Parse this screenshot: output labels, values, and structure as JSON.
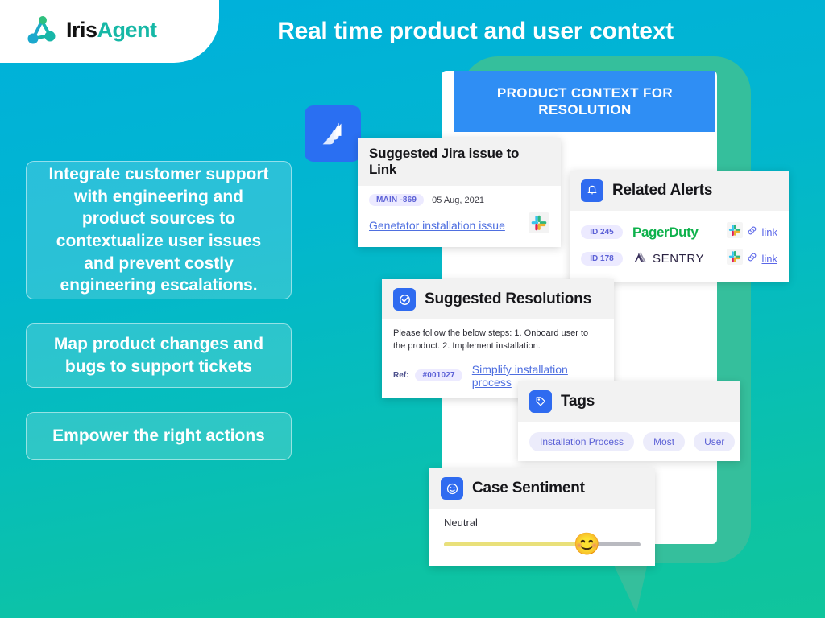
{
  "brand": {
    "logo_iris": "Iris",
    "logo_agent": "Agent",
    "logo_icon": "molecule-icon",
    "accent_blue": "#00b0dc",
    "accent_teal": "#10c59c",
    "logo_green": "#16b8a6"
  },
  "header": {
    "title": "Real time product and user context"
  },
  "features": [
    {
      "text": "Integrate customer support with engineering and product sources to contextualize user issues and prevent costly engineering escalations."
    },
    {
      "text": "Map product changes and bugs to support tickets"
    },
    {
      "text": "Empower the right actions"
    }
  ],
  "product_context": {
    "banner_title": "PRODUCT CONTEXT FOR RESOLUTION",
    "banner_color": "#2f8ef4",
    "bubble_color": "#35bf9c"
  },
  "jira": {
    "app_icon": "jira-icon",
    "title": "Suggested Jira issue to Link",
    "issue_key": "MAIN -869",
    "date": "05 Aug, 2021",
    "issue_title": "Genetator installation issue",
    "slack_icon": "slack-icon"
  },
  "alerts": {
    "icon": "bell-icon",
    "title": "Related Alerts",
    "rows": [
      {
        "id": "ID 245",
        "source": "PagerDuty",
        "source_icon": "pagerduty-logo",
        "slack_icon": "slack-icon",
        "link_icon": "chain-link-icon",
        "link_label": "link"
      },
      {
        "id": "ID 178",
        "source": "SENTRY",
        "source_icon": "sentry-logo",
        "slack_icon": "slack-icon",
        "link_icon": "chain-link-icon",
        "link_label": "link"
      }
    ]
  },
  "resolutions": {
    "icon": "check-circle-icon",
    "title": "Suggested Resolutions",
    "body": "Please follow the below steps: 1. Onboard user to the product. 2. Implement installation.",
    "ref_label": "Ref:",
    "ref_id": "#001027",
    "ref_link": "Simplify installation process"
  },
  "tags": {
    "icon": "tag-icon",
    "title": "Tags",
    "items": [
      "Installation Process",
      "Most",
      "User"
    ]
  },
  "sentiment": {
    "icon": "smiley-icon",
    "title": "Case Sentiment",
    "value_label": "Neutral",
    "value_percent": 72,
    "thumb_emoji": "😊",
    "fill_color": "#e9e07a",
    "track_color": "#b9bac0"
  }
}
